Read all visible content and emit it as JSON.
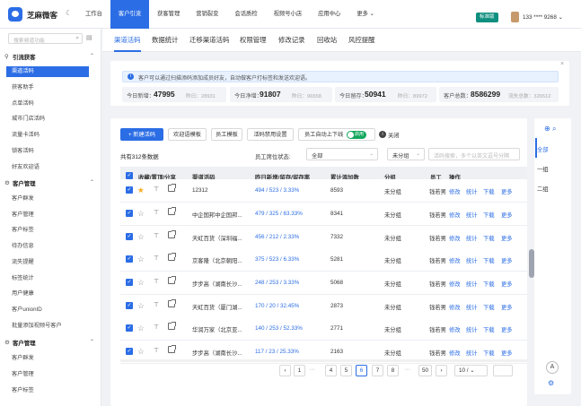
{
  "header": {
    "brand": "芝麻微客",
    "theme_icon": "moon-icon",
    "nav": [
      "工作台",
      "客户引流",
      "获客管理",
      "营销裂变",
      "会话质检",
      "视频号小店",
      "应用中心",
      "更多 ⌄"
    ],
    "active_nav": 1,
    "edition": "标准版",
    "account": "133 **** 9268 ⌄"
  },
  "sidebar": {
    "search_placeholder": "搜索频道功能",
    "groups": [
      {
        "title": "引流获客",
        "items": [
          "渠道活码",
          "获客助手",
          "点单活码",
          "城市门店活码",
          "流量卡活码",
          "锁客活码",
          "好友欢迎语"
        ],
        "active": 0
      },
      {
        "title": "客户管理",
        "items": [
          "客户群发",
          "客户管理",
          "客户标签",
          "待办信息",
          "流失提醒",
          "标签统计",
          "用户健康",
          "客户unionID",
          "批量添加视频号客户"
        ]
      },
      {
        "title": "客户管理",
        "items": [
          "客户群发",
          "客户管理",
          "客户标签"
        ]
      }
    ]
  },
  "tabs": [
    "渠道活码",
    "数据统计",
    "迁移渠道活码",
    "权限管理",
    "修改记录",
    "回收站",
    "风控提醒"
  ],
  "notice": "客户可以通过扫描添码添加成员好友，自动做客户打标签和发送欢迎语。",
  "stats": [
    {
      "label": "今日新增：",
      "value": "47995",
      "sub": "昨日：28931"
    },
    {
      "label": "今日净增：",
      "value": "91807",
      "sub": "昨日：96558"
    },
    {
      "label": "今日留存：",
      "value": "50941",
      "sub": "昨日：89972"
    },
    {
      "label": "客户总数：",
      "value": "8586299",
      "sub": "流失总数：326512"
    }
  ],
  "toolbar": {
    "new_button": "+ 新建活码",
    "buttons": [
      "欢迎语模板",
      "员工模板",
      "活码禁用设置",
      "员工自动上下线"
    ],
    "toggle_label": "启用",
    "off_label": "关闭"
  },
  "filter": {
    "count": "共有312条数据",
    "status_label": "员工席位状态:",
    "status_value": "全部",
    "group_value": "未分组",
    "search_placeholder": "活码搜索，多个以英文逗号分隔"
  },
  "table": {
    "headers": [
      "收藏/置顶/分享",
      "渠道活码",
      "昨日新增/留存/留存率",
      "累计添加数",
      "分组",
      "员工",
      "操作"
    ],
    "rows": [
      {
        "starred": true,
        "name": "12312",
        "stats": "494 / 523 / 3.33%",
        "total": "8593",
        "group": "未分组",
        "staff": "钱若男"
      },
      {
        "starred": false,
        "name": "中企国邦中企国邦...",
        "stats": "479 / 325 / 63.33%",
        "total": "8341",
        "group": "未分组",
        "staff": "钱若男"
      },
      {
        "starred": false,
        "name": "天虹百货（深圳福...",
        "stats": "456 / 212 / 2.33%",
        "total": "7332",
        "group": "未分组",
        "staff": "钱若男"
      },
      {
        "starred": false,
        "name": "京客隆（北京朝阳...",
        "stats": "375 / 523 / 6.33%",
        "total": "5281",
        "group": "未分组",
        "staff": "钱若男"
      },
      {
        "starred": false,
        "name": "步步高（湖南长沙...",
        "stats": "248 / 253 / 3.33%",
        "total": "5068",
        "group": "未分组",
        "staff": "钱若男"
      },
      {
        "starred": false,
        "name": "天虹百货（厦门湖...",
        "stats": "170 / 20 / 32.45%",
        "total": "2873",
        "group": "未分组",
        "staff": "钱若男"
      },
      {
        "starred": false,
        "name": "华润万家（北京亚...",
        "stats": "140 / 253 / 52.33%",
        "total": "2771",
        "group": "未分组",
        "staff": "钱若男"
      },
      {
        "starred": false,
        "name": "步步高（湖南长沙...",
        "stats": "117 / 23 / 25.33%",
        "total": "2163",
        "group": "未分组",
        "staff": "钱若男"
      }
    ],
    "actions": [
      "修改",
      "统计",
      "下载",
      "更多"
    ]
  },
  "pagination": {
    "prev": "‹",
    "pages": [
      "1",
      "4",
      "5",
      "6",
      "7",
      "8",
      "50"
    ],
    "current": "6",
    "next": "›",
    "page_size": "10 / ⌄"
  },
  "right_panel": {
    "items": [
      "全部",
      "一组",
      "二组"
    ],
    "active": 0
  }
}
